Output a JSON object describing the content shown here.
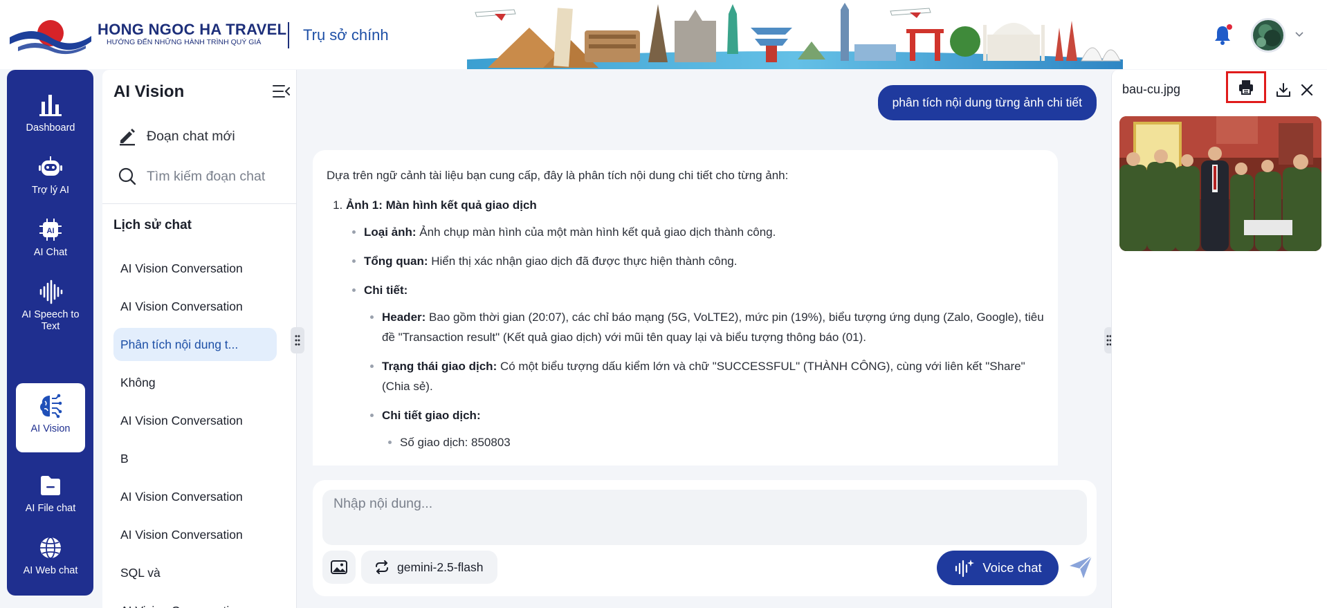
{
  "header": {
    "brand_name": "HONG NGOC HA TRAVEL",
    "tagline": "HƯỚNG ĐẾN NHỮNG HÀNH TRÌNH QUÝ GIÁ",
    "branch": "Trụ sở chính",
    "notification_icon": "bell-icon",
    "notification_dot_color": "#e0283c"
  },
  "nav": {
    "items": [
      {
        "label": "Dashboard",
        "icon": "bar-chart-icon"
      },
      {
        "label": "Trợ lý AI",
        "icon": "robot-icon"
      },
      {
        "label": "AI Chat",
        "icon": "ai-chip-icon"
      },
      {
        "label": "AI Speech to Text",
        "icon": "sound-wave-icon"
      },
      {
        "label": "AI Vision",
        "icon": "brain-circuit-icon",
        "active": true
      },
      {
        "label": "AI File chat",
        "icon": "folder-icon"
      },
      {
        "label": "AI Web chat",
        "icon": "globe-icon"
      }
    ]
  },
  "chat_panel": {
    "title": "AI Vision",
    "new_chat": "Đoạn chat mới",
    "search_placeholder": "Tìm kiếm đoạn chat",
    "history_title": "Lịch sử chat",
    "history": [
      "AI Vision Conversation",
      "AI Vision Conversation",
      "Phân tích nội dung t...",
      "Không",
      "AI Vision Conversation",
      "B",
      "AI Vision Conversation",
      "AI Vision Conversation",
      "SQL và",
      "AI Vision Conversation"
    ],
    "active_index": 2
  },
  "conversation": {
    "user_message": "phân tích nội dung từng ảnh chi tiết",
    "ai_intro": "Dựa trên ngữ cảnh tài liệu bạn cung cấp, đây là phân tích nội dung chi tiết cho từng ảnh:",
    "section1_title": "Ảnh 1: Màn hình kết quả giao dịch",
    "type_label": "Loại ảnh:",
    "type_text": " Ảnh chụp màn hình của một màn hình kết quả giao dịch thành công.",
    "overview_label": "Tổng quan:",
    "overview_text": " Hiển thị xác nhận giao dịch đã được thực hiện thành công.",
    "details_label": "Chi tiết:",
    "header_label": "Header:",
    "header_text": " Bao gồm thời gian (20:07), các chỉ báo mạng (5G, VoLTE2), mức pin (19%), biểu tượng ứng dụng (Zalo, Google), tiêu đề \"Transaction result\" (Kết quả giao dịch) với mũi tên quay lại và biểu tượng thông báo (01).",
    "status_label": "Trạng thái giao dịch:",
    "status_text": " Có một biểu tượng dấu kiểm lớn và chữ \"SUCCESSFUL\" (THÀNH CÔNG), cùng với liên kết \"Share\" (Chia sẻ).",
    "tx_label": "Chi tiết giao dịch:",
    "tx_number": "Số giao dịch: 850803"
  },
  "composer": {
    "placeholder": "Nhập nội dung...",
    "model": "gemini-2.5-flash",
    "voice_label": "Voice chat"
  },
  "preview": {
    "file_name": "bau-cu.jpg",
    "print_icon": "printer-icon",
    "download_icon": "download-icon",
    "close_icon": "close-icon",
    "highlight_color": "#e01b1b"
  },
  "colors": {
    "nav_bg": "#1f2f8f",
    "accent": "#1f3a9e",
    "active_chat_bg": "#e3eefc"
  }
}
